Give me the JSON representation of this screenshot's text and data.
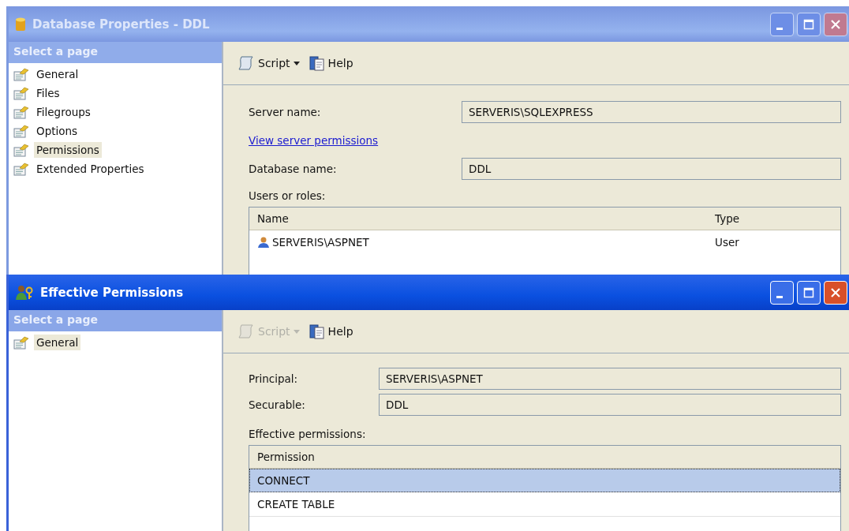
{
  "windows": [
    {
      "kind": "properties",
      "active": false,
      "title": "Database Properties - DDL",
      "sidebar": {
        "header": "Select a page",
        "items": [
          {
            "label": "General",
            "selected": false
          },
          {
            "label": "Files",
            "selected": false
          },
          {
            "label": "Filegroups",
            "selected": false
          },
          {
            "label": "Options",
            "selected": false
          },
          {
            "label": "Permissions",
            "selected": true
          },
          {
            "label": "Extended Properties",
            "selected": false
          }
        ]
      },
      "toolbar": [
        {
          "kind": "script",
          "label": "Script",
          "disabled": false
        },
        {
          "kind": "help",
          "label": "Help",
          "disabled": false
        }
      ],
      "form": [
        {
          "kind": "field",
          "label": "Server name:",
          "value": "SERVERIS\\SQLEXPRESS"
        },
        {
          "kind": "link",
          "label": "View server permissions"
        },
        {
          "kind": "field",
          "label": "Database name:",
          "value": "DDL"
        },
        {
          "kind": "grid",
          "label": "Users or roles:",
          "columns": [
            "Name",
            "Type"
          ],
          "rows": [
            {
              "kind": "user",
              "cells": [
                "SERVERIS\\ASPNET",
                "User"
              ],
              "selected": false
            }
          ]
        }
      ]
    },
    {
      "kind": "effective",
      "active": true,
      "title": "Effective Permissions",
      "sidebar": {
        "header": "Select a page",
        "items": [
          {
            "label": "General",
            "selected": true
          }
        ]
      },
      "toolbar": [
        {
          "kind": "script",
          "label": "Script",
          "disabled": true
        },
        {
          "kind": "help",
          "label": "Help",
          "disabled": false
        }
      ],
      "form": [
        {
          "kind": "field",
          "label": "Principal:",
          "value": "SERVERIS\\ASPNET"
        },
        {
          "kind": "field",
          "label": "Securable:",
          "value": "DDL"
        },
        {
          "kind": "grid",
          "label": "Effective permissions:",
          "columns": [
            "Permission"
          ],
          "rows": [
            {
              "kind": "permission",
              "cells": [
                "CONNECT"
              ],
              "selected": true
            },
            {
              "kind": "permission",
              "cells": [
                "CREATE TABLE"
              ],
              "selected": false
            }
          ]
        }
      ]
    }
  ]
}
